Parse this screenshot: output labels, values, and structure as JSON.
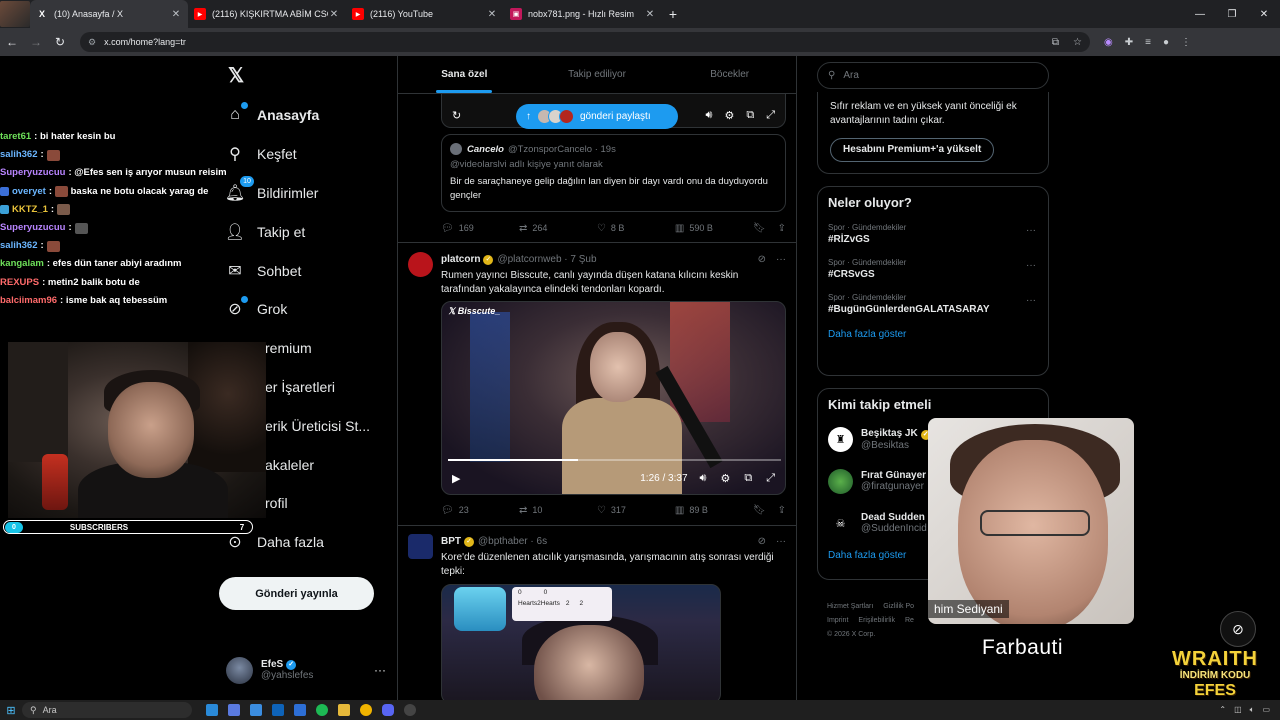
{
  "browser": {
    "tabs": [
      {
        "title": "(10) Anasayfa / X",
        "icon": "x-logo-icon",
        "active": true
      },
      {
        "title": "(2116) KIŞKIRTMA ABİM CSGO",
        "icon": "youtube-icon",
        "active": false
      },
      {
        "title": "(2116) YouTube",
        "icon": "youtube-icon",
        "active": false
      },
      {
        "title": "nobx781.png - Hızlı Resim",
        "icon": "image-host-icon",
        "active": false
      }
    ],
    "url": "x.com/home?lang=tr"
  },
  "chat": [
    {
      "user": "taret61",
      "color": "#6ee05a",
      "message": ": bi hater kesin bu",
      "emote": false
    },
    {
      "user": "salih362",
      "color": "#6bb6ff",
      "message": ":",
      "emote": true
    },
    {
      "user": "Superyuzucuu",
      "color": "#b985ff",
      "message": ": @Efes sen iş arıyor musun reisim",
      "emote": false
    },
    {
      "user": "overyet",
      "color": "#6bb6ff",
      "message": ":",
      "emote": true,
      "after": " baska ne botu olacak yarag de"
    },
    {
      "user": "KKTZ_1",
      "color": "#e8c23a",
      "message": ":",
      "emote": true
    },
    {
      "user": "Superyuzucuu",
      "color": "#b985ff",
      "message": ":",
      "emote": true
    },
    {
      "user": "salih362",
      "color": "#6bb6ff",
      "message": ":",
      "emote": true
    },
    {
      "user": "kangalam",
      "color": "#6ee05a",
      "message": ": efes dün taner abiyi aradınm",
      "emote": false
    },
    {
      "user": "REXUPS",
      "color": "#ff6b6b",
      "message": ": metin2 balik botu de",
      "emote": false
    },
    {
      "user": "balciimam96",
      "color": "#ff6b6b",
      "message": ": isme bak aq tebessüm",
      "emote": false
    }
  ],
  "subscribers": {
    "label": "SUBSCRIBERS",
    "current": "0",
    "goal": "7",
    "accent": "#17c4e8"
  },
  "nav": {
    "items": [
      {
        "label": "Anasayfa",
        "icon": "home-icon",
        "bold": true
      },
      {
        "label": "Keşfet",
        "icon": "search-icon"
      },
      {
        "label": "Bildirimler",
        "icon": "bell-icon",
        "badge": "10"
      },
      {
        "label": "Takip et",
        "icon": "add-person-icon"
      },
      {
        "label": "Sohbet",
        "icon": "mail-icon"
      },
      {
        "label": "Grok",
        "icon": "grok-icon"
      },
      {
        "label": "remium",
        "icon": ""
      },
      {
        "label": "er İşaretleri",
        "icon": ""
      },
      {
        "label": "erik Üreticisi St...",
        "icon": ""
      },
      {
        "label": "akaleler",
        "icon": ""
      },
      {
        "label": "rofil",
        "icon": ""
      },
      {
        "label": "Daha fazla",
        "icon": "more-circle-icon"
      }
    ],
    "post_button": "Gönderi yayınla",
    "account": {
      "name": "EfeS",
      "handle": "@yahslefes"
    }
  },
  "timeline": {
    "tabs": [
      "Sana özel",
      "Takip ediliyor",
      "Böcekler"
    ],
    "share_pill": "gönderi paylaştı",
    "quote": {
      "name": "Cancelo",
      "handle": "@TzonsporCancelo · 19s",
      "reply_to": "@videolarslvi adlı kişiye yanıt olarak",
      "text": "Bir de saraçhaneye gelip dağılın lan diyen bir dayı vardı onu da duyduyordu gençler"
    },
    "tweet1_actions": {
      "replies": "169",
      "reposts": "264",
      "likes": "8 B",
      "views": "590 B"
    },
    "tweet2": {
      "name": "platcorn",
      "handle": "@platcornweb · 7 Şub",
      "text": "Rumen yayıncı Bisscute, canlı yayında düşen katana kılıcını keskin tarafından yakalayınca elindeki tendonları kopardı.",
      "watermark": "Bisscute_",
      "time": "1:26 / 3:37",
      "progress": 0.39,
      "actions": {
        "replies": "23",
        "reposts": "10",
        "likes": "317",
        "views": "89 B"
      }
    },
    "tweet3": {
      "name": "BPT",
      "handle": "@bpthaber · 6s",
      "text": "Kore'de düzenlenen atıcılık yarışmasında, yarışmacının atış sonrası verdiği tepki:",
      "score_rows": [
        [
          "0",
          "0"
        ],
        [
          "Hearts2Hearts",
          "2",
          "2"
        ]
      ]
    }
  },
  "right": {
    "search_placeholder": "Ara",
    "premium_text": "Sıfır reklam ve en yüksek yanıt önceliği ek avantajlarının tadını çıkar.",
    "premium_button": "Hesabını Premium+'a yükselt",
    "trends_title": "Neler oluyor?",
    "trends": [
      {
        "meta": "Spor · Gündemdekiler",
        "tag": "#RİZvGS"
      },
      {
        "meta": "Spor · Gündemdekiler",
        "tag": "#CRSvGS"
      },
      {
        "meta": "Spor · Gündemdekiler",
        "tag": "#BugünGünlerdenGALATASARAY"
      }
    ],
    "show_more": "Daha fazla göster",
    "follow_title": "Kimi takip etmeli",
    "follow": [
      {
        "name": "Beşiktaş JK",
        "handle": "@Besiktas"
      },
      {
        "name": "Fırat Günayer",
        "handle": "@firatgunayer"
      },
      {
        "name": "Dead Sudden",
        "handle": "@SuddenIncid"
      }
    ],
    "follow_show_more": "Daha fazla göster",
    "footer": [
      "Hizmet Şartları",
      "Gizlilik Po",
      "Imprint",
      "Erişilebilirlik",
      "Re",
      "© 2026 X Corp."
    ]
  },
  "overlay": {
    "facecam_label": "him Sediyani",
    "name": "Farbauti",
    "promo1": "WRAITH",
    "promo2": "İNDİRİM KODU",
    "promo3": "EFES"
  },
  "taskbar": {
    "search": "Ara"
  }
}
